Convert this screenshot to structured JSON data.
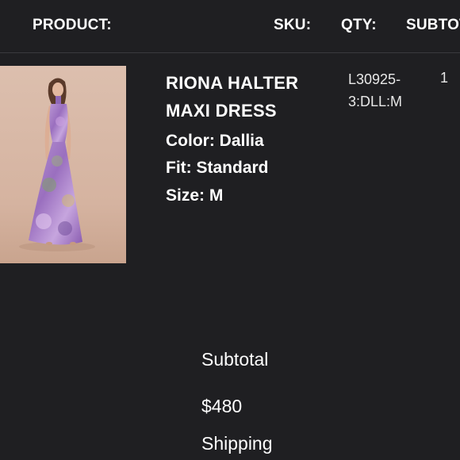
{
  "table_header": {
    "product": "PRODUCT:",
    "sku": "SKU:",
    "qty": "QTY:",
    "subtotal": "SUBTOTAL:"
  },
  "item": {
    "name": "RIONA HALTER MAXI DRESS",
    "color": "Color: Dallia",
    "fit": "Fit: Standard",
    "size": "Size: M",
    "sku": "L30925-3:DLL:M",
    "qty": "1",
    "image": "product-photo-purple-floral-maxi-dress"
  },
  "summary": {
    "subtotal_label": "Subtotal",
    "subtotal_value": "$480",
    "shipping_label": "Shipping"
  },
  "colors": {
    "background": "#1f1f22",
    "text": "#ffffff",
    "image_backdrop": "#d8b7a4",
    "dress_accent": "#a97ac8"
  }
}
